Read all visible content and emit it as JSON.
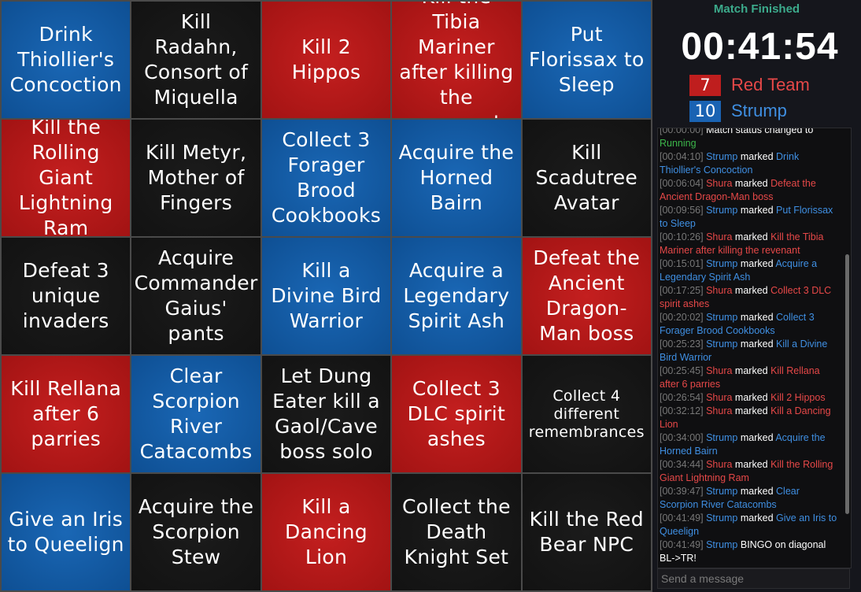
{
  "board": [
    {
      "text": "Drink Thiollier's Concoction",
      "team": "blue"
    },
    {
      "text": "Kill Radahn, Consort of Miquella",
      "team": "none"
    },
    {
      "text": "Kill 2 Hippos",
      "team": "red"
    },
    {
      "text": "Kill the Tibia Mariner after killing the revenant",
      "team": "red"
    },
    {
      "text": "Put Florissax to Sleep",
      "team": "blue"
    },
    {
      "text": "Kill the Rolling Giant Lightning Ram",
      "team": "red"
    },
    {
      "text": "Kill Metyr, Mother of Fingers",
      "team": "none"
    },
    {
      "text": "Collect 3 Forager Brood Cookbooks",
      "team": "blue"
    },
    {
      "text": "Acquire the Horned Bairn",
      "team": "blue"
    },
    {
      "text": "Kill Scadutree Avatar",
      "team": "none"
    },
    {
      "text": "Defeat 3 unique invaders",
      "team": "none"
    },
    {
      "text": "Acquire Commander Gaius' pants",
      "team": "none"
    },
    {
      "text": "Kill a Divine Bird Warrior",
      "team": "blue"
    },
    {
      "text": "Acquire a Legendary Spirit Ash",
      "team": "blue"
    },
    {
      "text": "Defeat the Ancient Dragon-Man boss",
      "team": "red"
    },
    {
      "text": "Kill Rellana after 6 parries",
      "team": "red"
    },
    {
      "text": "Clear Scorpion River Catacombs",
      "team": "blue"
    },
    {
      "text": "Let Dung Eater kill a Gaol/Cave boss solo",
      "team": "none"
    },
    {
      "text": "Collect 3 DLC spirit ashes",
      "team": "red"
    },
    {
      "text": "Collect 4 different remembrances",
      "team": "none",
      "small": true
    },
    {
      "text": "Give an Iris to Queelign",
      "team": "blue"
    },
    {
      "text": "Acquire the Scorpion Stew",
      "team": "none"
    },
    {
      "text": "Kill a Dancing Lion",
      "team": "red"
    },
    {
      "text": "Collect the Death Knight Set",
      "team": "none"
    },
    {
      "text": "Kill the Red Bear NPC",
      "team": "none"
    }
  ],
  "sidebar": {
    "status": "Match Finished",
    "timer": "00:41:54",
    "teams": [
      {
        "count": "7",
        "name": "Red Team",
        "color": "#bf1e1e"
      },
      {
        "count": "10",
        "name": "Strump",
        "color": "#1a63b3"
      }
    ]
  },
  "log": [
    {
      "time": "[00:00:00]",
      "who": "",
      "action": "Match status changed to ",
      "goal": "Running",
      "gclass": "gt"
    },
    {
      "time": "[00:04:10]",
      "who": "Strump",
      "wclass": "bt",
      "action": " marked ",
      "goal": "Drink Thiollier's Concoction",
      "gclass": "bt"
    },
    {
      "time": "[00:06:04]",
      "who": "Shura",
      "wclass": "rt",
      "action": " marked ",
      "goal": "Defeat the Ancient Dragon-Man boss",
      "gclass": "rt"
    },
    {
      "time": "[00:09:56]",
      "who": "Strump",
      "wclass": "bt",
      "action": " marked ",
      "goal": "Put Florissax to Sleep",
      "gclass": "bt"
    },
    {
      "time": "[00:10:26]",
      "who": "Shura",
      "wclass": "rt",
      "action": " marked ",
      "goal": "Kill the Tibia Mariner after killing the revenant",
      "gclass": "rt"
    },
    {
      "time": "[00:15:01]",
      "who": "Strump",
      "wclass": "bt",
      "action": " marked ",
      "goal": "Acquire a Legendary Spirit Ash",
      "gclass": "bt"
    },
    {
      "time": "[00:17:25]",
      "who": "Shura",
      "wclass": "rt",
      "action": " marked ",
      "goal": "Collect 3 DLC spirit ashes",
      "gclass": "rt"
    },
    {
      "time": "[00:20:02]",
      "who": "Strump",
      "wclass": "bt",
      "action": " marked ",
      "goal": "Collect 3 Forager Brood Cookbooks",
      "gclass": "bt"
    },
    {
      "time": "[00:25:23]",
      "who": "Strump",
      "wclass": "bt",
      "action": " marked ",
      "goal": "Kill a Divine Bird Warrior",
      "gclass": "bt"
    },
    {
      "time": "[00:25:45]",
      "who": "Shura",
      "wclass": "rt",
      "action": " marked ",
      "goal": "Kill Rellana after 6 parries",
      "gclass": "rt"
    },
    {
      "time": "[00:26:54]",
      "who": "Shura",
      "wclass": "rt",
      "action": " marked ",
      "goal": "Kill 2 Hippos",
      "gclass": "rt"
    },
    {
      "time": "[00:32:12]",
      "who": "Shura",
      "wclass": "rt",
      "action": " marked ",
      "goal": "Kill a Dancing Lion",
      "gclass": "rt"
    },
    {
      "time": "[00:34:00]",
      "who": "Strump",
      "wclass": "bt",
      "action": " marked ",
      "goal": "Acquire the Horned Bairn",
      "gclass": "bt"
    },
    {
      "time": "[00:34:44]",
      "who": "Shura",
      "wclass": "rt",
      "action": " marked ",
      "goal": "Kill the Rolling Giant Lightning Ram",
      "gclass": "rt"
    },
    {
      "time": "[00:39:47]",
      "who": "Strump",
      "wclass": "bt",
      "action": " marked ",
      "goal": "Clear Scorpion River Catacombs",
      "gclass": "bt"
    },
    {
      "time": "[00:41:49]",
      "who": "Strump",
      "wclass": "bt",
      "action": " marked ",
      "goal": "Give an Iris to Queelign",
      "gclass": "bt"
    },
    {
      "time": "[00:41:49]",
      "who": "Strump",
      "wclass": "bt",
      "action": " BINGO on diagonal BL->TR!",
      "goal": "",
      "gclass": ""
    }
  ],
  "chat": {
    "placeholder": "Send a message"
  }
}
